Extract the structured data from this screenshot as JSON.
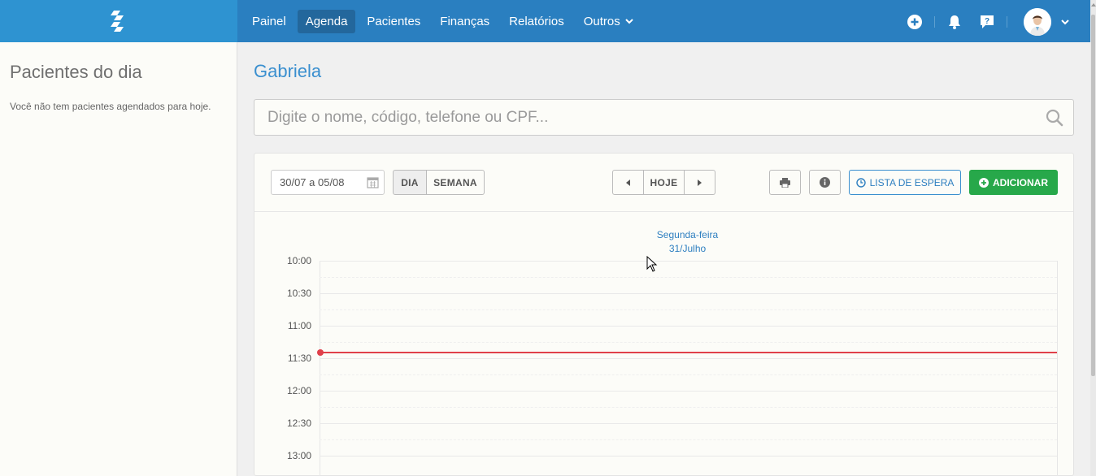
{
  "nav": {
    "items": [
      {
        "label": "Painel"
      },
      {
        "label": "Agenda",
        "active": true
      },
      {
        "label": "Pacientes"
      },
      {
        "label": "Finanças"
      },
      {
        "label": "Relatórios"
      },
      {
        "label": "Outros"
      }
    ]
  },
  "sidebar": {
    "title": "Pacientes do dia",
    "empty_text": "Você não tem pacientes agendados para hoje."
  },
  "main": {
    "title": "Gabriela",
    "search_placeholder": "Digite o nome, código, telefone ou CPF..."
  },
  "toolbar": {
    "date_range": "30/07 a 05/08",
    "view_day": "DIA",
    "view_week": "SEMANA",
    "today": "HOJE",
    "waitlist": "LISTA DE ESPERA",
    "add": "ADICIONAR"
  },
  "calendar": {
    "weekday": "Segunda-feira",
    "date": "31/Julho",
    "times": [
      "10:00",
      "10:30",
      "11:00",
      "11:30",
      "12:00",
      "12:30",
      "13:00"
    ]
  },
  "colors": {
    "topbar": "#2a7fc0",
    "accent": "#3a8fcf",
    "add_button": "#27a84a",
    "now_line": "#e0404a"
  },
  "icons": [
    "logo-icon",
    "chevron-down-icon",
    "plus-circle-icon",
    "bell-icon",
    "help-icon",
    "calendar-icon",
    "caret-left-icon",
    "caret-right-icon",
    "print-icon",
    "info-icon",
    "clock-icon",
    "search-icon"
  ]
}
